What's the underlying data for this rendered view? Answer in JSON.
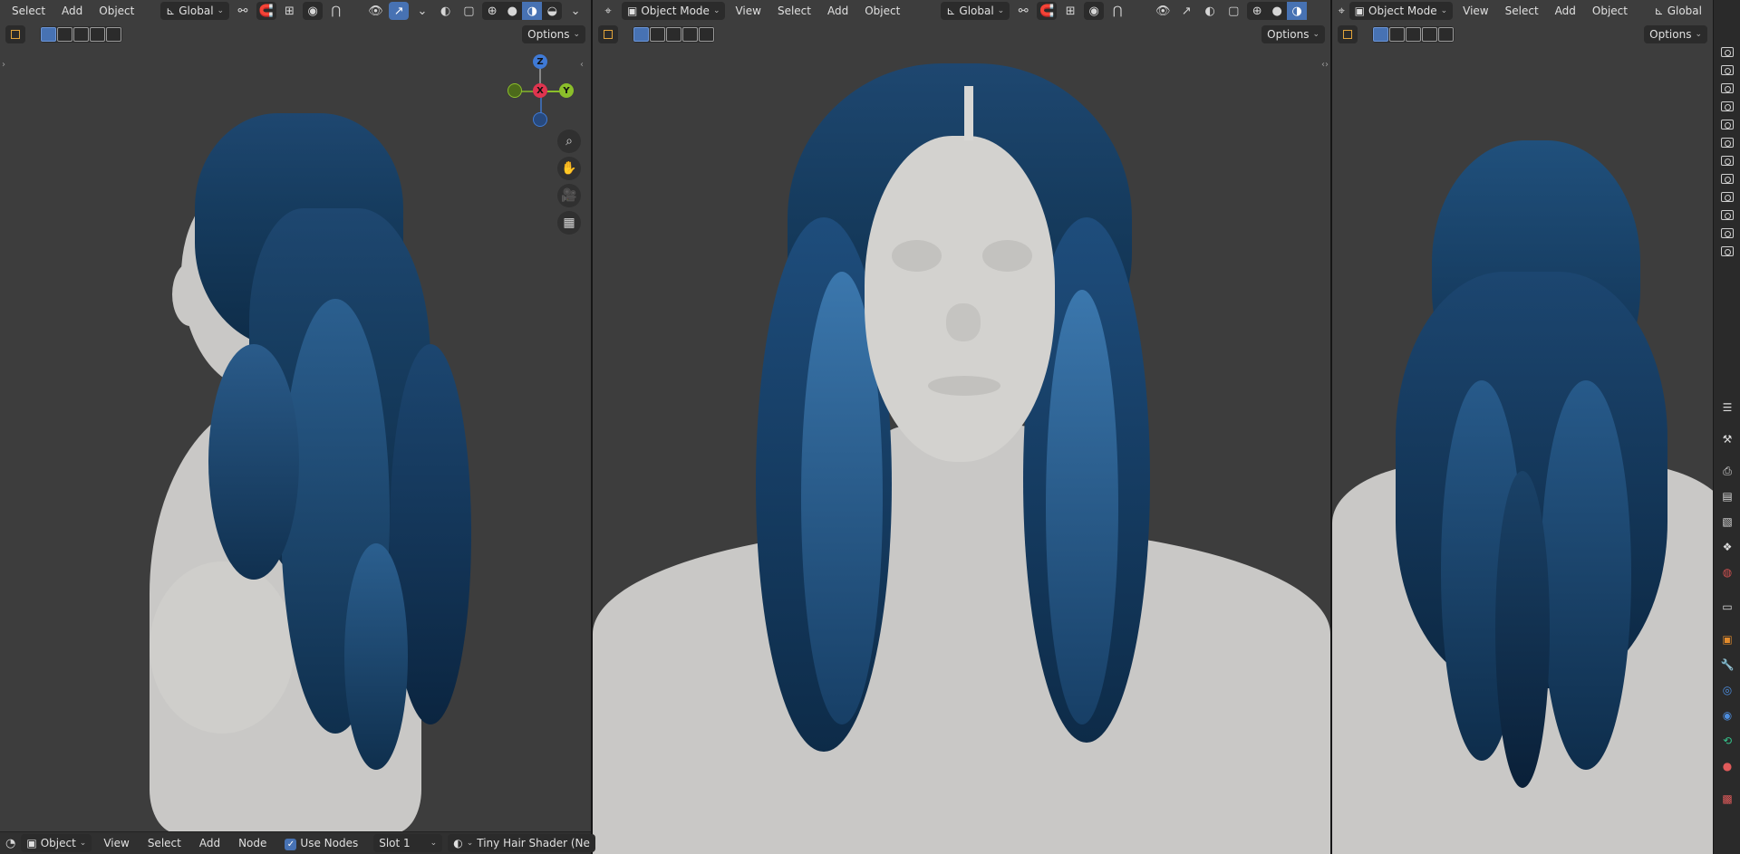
{
  "left": {
    "menus": [
      "Select",
      "Add",
      "Object"
    ],
    "orientation": "Global",
    "options_label": "Options",
    "gizmo": {
      "z": "Z",
      "x": "X",
      "y": "Y"
    }
  },
  "center": {
    "mode": "Object Mode",
    "menus": [
      "View",
      "Select",
      "Add",
      "Object"
    ],
    "orientation": "Global",
    "options_label": "Options"
  },
  "right": {
    "mode": "Object Mode",
    "menus": [
      "View",
      "Select",
      "Add",
      "Object"
    ],
    "orientation": "Global",
    "options_label": "Options"
  },
  "bottom": {
    "object_type": "Object",
    "menus": [
      "View",
      "Select",
      "Add",
      "Node"
    ],
    "use_nodes_label": "Use Nodes",
    "use_nodes_checked": true,
    "slot": "Slot 1",
    "material": "Tiny Hair Shader (Ne"
  },
  "colors": {
    "viewport_bg": "#3d3d3d",
    "accent": "#4772b3",
    "hair": "#1b4a76",
    "skin": "#c9c8c6",
    "gizmo_x": "#e0344f",
    "gizmo_y": "#8bbf2a",
    "gizmo_z": "#3f7ad6"
  }
}
